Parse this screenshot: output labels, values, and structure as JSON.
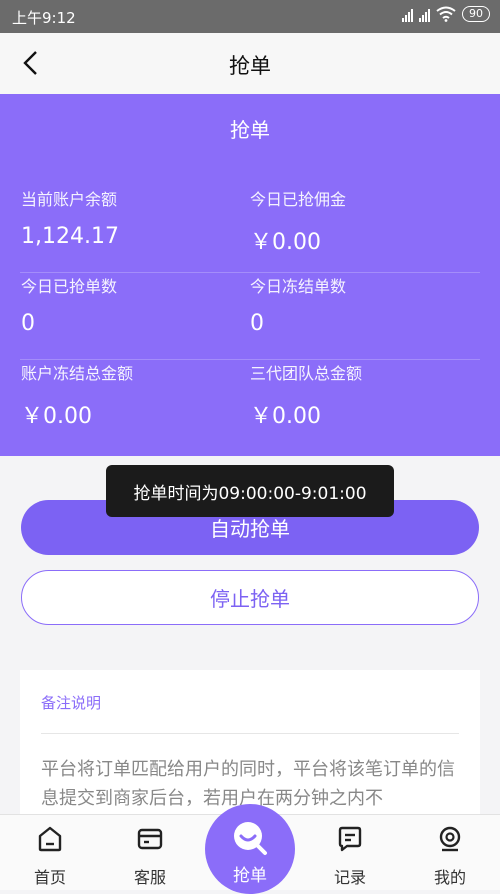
{
  "status_bar": {
    "time": "上午9:12",
    "battery": "90"
  },
  "nav": {
    "title": "抢单"
  },
  "panel": {
    "title": "抢单",
    "stats": [
      {
        "label": "当前账户余额",
        "value": "1,124.17"
      },
      {
        "label": "今日已抢佣金",
        "value": "￥0.00"
      },
      {
        "label": "今日已抢单数",
        "value": "0"
      },
      {
        "label": "今日冻结单数",
        "value": "0"
      },
      {
        "label": "账户冻结总金额",
        "value": "￥0.00"
      },
      {
        "label": "三代团队总金额",
        "value": "￥0.00"
      }
    ]
  },
  "toast": "抢单时间为09:00:00-9:01:00",
  "buttons": {
    "auto": "自动抢单",
    "stop": "停止抢单"
  },
  "notes": {
    "title": "备注说明",
    "body": "平台将订单匹配给用户的同时，平台将该笔订单的信息提交到商家后台，若用户在两分钟之内不"
  },
  "tabs": [
    {
      "label": "首页",
      "icon": "home-icon"
    },
    {
      "label": "客服",
      "icon": "service-icon"
    },
    {
      "label": "抢单",
      "icon": "grab-order-icon"
    },
    {
      "label": "记录",
      "icon": "records-icon"
    },
    {
      "label": "我的",
      "icon": "profile-icon"
    }
  ],
  "colors": {
    "accent": "#8b6df9",
    "button": "#7c62f3",
    "status_bar": "#6b6b6b"
  }
}
